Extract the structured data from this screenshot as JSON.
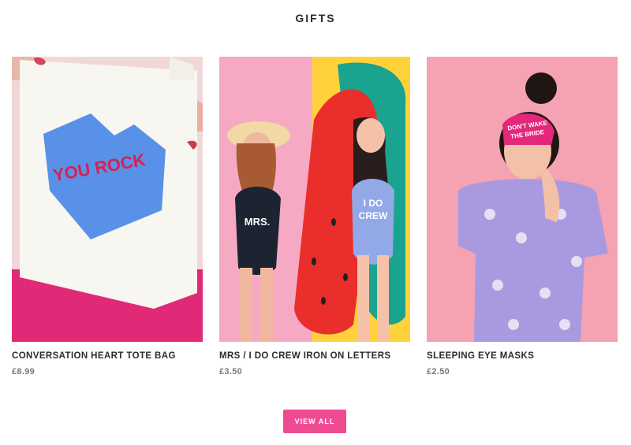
{
  "section": {
    "title": "GIFTS"
  },
  "products": [
    {
      "name": "CONVERSATION HEART TOTE BAG",
      "price": "£8.99",
      "image_text": "YOU ROCK"
    },
    {
      "name": "MRS / I DO CREW IRON ON LETTERS",
      "price": "£3.50",
      "image_text_left": "MRS.",
      "image_text_right_1": "I DO",
      "image_text_right_2": "CREW"
    },
    {
      "name": "SLEEPING EYE MASKS",
      "price": "£2.50",
      "image_text_1": "DON'T WAKE",
      "image_text_2": "THE BRIDE"
    }
  ],
  "cta": {
    "label": "VIEW ALL"
  },
  "colors": {
    "accent": "#ee4b93",
    "text": "#2b2b2b",
    "muted": "#7a7a7a"
  }
}
